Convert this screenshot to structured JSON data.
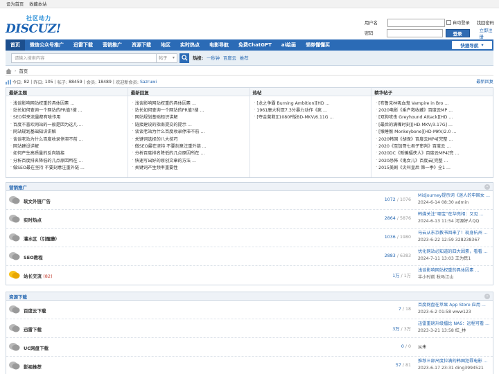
{
  "topbar": {
    "set_home": "设为首页",
    "bookmark": "收藏本站"
  },
  "logo": {
    "cn": "社区动力",
    "en": "DISCUZ!"
  },
  "login": {
    "username_label": "用户名",
    "password_label": "密码",
    "auto_login": "自动登录",
    "forgot": "找回密码",
    "login_button": "登录",
    "register": "立即注册"
  },
  "nav": {
    "items": [
      "首页",
      "微信公众号推广",
      "迅雷下载",
      "营销推广",
      "资源下载",
      "地区",
      "实时热点",
      "电影导航",
      "免费ChatGPT",
      "ai绘画",
      "领券懂懂买"
    ],
    "quick": "快捷导航"
  },
  "search": {
    "placeholder": "请输入搜索内容",
    "type": "帖子",
    "hot_label": "热搜:",
    "hot": [
      "一秒钟",
      "百度云",
      "推荐"
    ]
  },
  "breadcrumb": {
    "current": "首页"
  },
  "stats": {
    "today_label": "今日:",
    "today": "82",
    "yesterday_label": "昨日:",
    "yesterday": "105",
    "posts_label": "帖子:",
    "posts": "88459",
    "members_label": "会员:",
    "members": "18489",
    "welcome": "欢迎新会员:",
    "new_member": "Sazruwi",
    "latest_reply": "最新回复"
  },
  "panels": [
    {
      "title": "最新主题",
      "items": [
        "浅谈影响网站权重的具体因素 ...",
        "站长如何查询一个网站的PR值?搜 ...",
        "SEO带来流量都有啥作用",
        "百度不喜欢网站的一般是因为这几 ...",
        "网站规划基础知识讲解",
        "谈谈老站为什么百度收录停滞不前 ...",
        "网站建设详解",
        "如何产生高质量的反向链接",
        "分析百度排名降低的几点原因所在 ...",
        "做SEO最在坚持 不要刻意注重外链 ..."
      ]
    },
    {
      "title": "最新回复",
      "items": [
        "浅谈影响网站权重的具体因素 ...",
        "站长如何查询一个网站的PR值?搜 ...",
        "网站规划基础知识讲解",
        "链接建设的指南提交的提示 ...",
        "谈谈老站为什么百度收录停滞不前 ...",
        "关键词选择的八大技巧",
        "做SEO最在坚持 不要刻意注重外链 ...",
        "分析百度排名降低的几点原因所在 ...",
        "快速写出好的原创文章的方法 ...",
        "关键词产生频率重要性"
      ]
    },
    {
      "title": "热帖",
      "items": [
        "[龙之争霸 Burning Ambition][HD ...",
        "1961康大利亚7.3分暴力动作《疯 ...",
        "[夺金营救][1080P版BD-MKV/6.11G ..."
      ]
    },
    {
      "title": "精华帖子",
      "items": [
        "[布鲁克林吸血鬼 Vampire in Bro ...",
        "2020电影《乘户救收藏》百度云MP ...",
        "[双狗攻击 Greyhound Attack][HD ...",
        "[最后的满嘴时刻][HD-MKV/3.17G] ...",
        "[猴睡猴 Monkeybone][HD-MKV/2.0 ...",
        "2020韩国《胡保》百度云MP4[完整 ...",
        "2020《至加哥七君子审判》百度云 ...",
        "2020DC《新蝙蝠侠人》百度云MP4[完 ...",
        "2020恐怖《鬼女儿》百度云[完整 ...",
        "2015美剧《尖叫皇后 第一季》全1 ..."
      ]
    }
  ],
  "sections": [
    {
      "title": "营销推广",
      "forums": [
        {
          "name": "软文外链广告",
          "today": "",
          "threads": "1072",
          "posts": "1076",
          "last_title": "Midjourney提示词《迷人的中国女 ...",
          "last_meta": "2024-6-14 08:30 admin",
          "icon": "chat-bubble-icon"
        },
        {
          "name": "实时热点",
          "today": "",
          "threads": "2864",
          "posts": "5876",
          "last_title": "韩媒关注“哪宝”在华亮相：又见 ...",
          "last_meta": "2024-6-13 11:54 河源好人QQ",
          "icon": "chat-bubble-icon"
        },
        {
          "name": "灌水区（引醒藤）",
          "today": "",
          "threads": "1036",
          "posts": "1980",
          "last_title": "马云从东京教书回来了！现身杭州 ...",
          "last_meta": "2023-6-22 12:59 328238367",
          "icon": "chat-bubble-icon"
        },
        {
          "name": "SEO教程",
          "today": "",
          "threads": "2883",
          "posts": "6383",
          "last_title": "优化网站必知道的四大因素，看看 ...",
          "last_meta": "2024-7-11 13:03 王为民1",
          "icon": "chat-bubble-icon"
        },
        {
          "name": "站长交流",
          "today": "(82)",
          "threads": "1万",
          "posts": "1万",
          "last_title": "浅谈影响网站权重的具体因素 ...",
          "last_meta": "半小时前 秋马江山",
          "icon": "chat-bubble-new-icon"
        }
      ]
    },
    {
      "title": "资源下载",
      "forums": [
        {
          "name": "百度云下载",
          "today": "",
          "threads": "7",
          "posts": "18",
          "last_title": "百度网盘在苹果 App Store 应用 ...",
          "last_meta": "2023-6-2 01:58 www123",
          "icon": "chat-bubble-icon"
        },
        {
          "name": "迅雷下载",
          "today": "",
          "threads": "3万",
          "posts": "3万",
          "last_title": "迅雷重磅升级擂比 NAS：远程可看 ...",
          "last_meta": "2023-3-21 13:58 红_林",
          "icon": "chat-bubble-icon"
        },
        {
          "name": "UC网盘下载",
          "today": "",
          "threads": "0",
          "posts": "0",
          "last_title": "",
          "last_meta": "",
          "last_never": "从未",
          "icon": "chat-bubble-icon"
        },
        {
          "name": "影视推荐",
          "today": "",
          "threads": "57",
          "posts": "81",
          "last_title": "推荐三部尺度拉满的韩国犯罪电影 ...",
          "last_meta": "2023-6-17 23:31 ding3994521",
          "icon": "chat-bubble-icon"
        }
      ]
    }
  ],
  "colors": {
    "nav": "#2b6bb6",
    "link": "#2466b0",
    "new_bubble": "#f5b400"
  }
}
